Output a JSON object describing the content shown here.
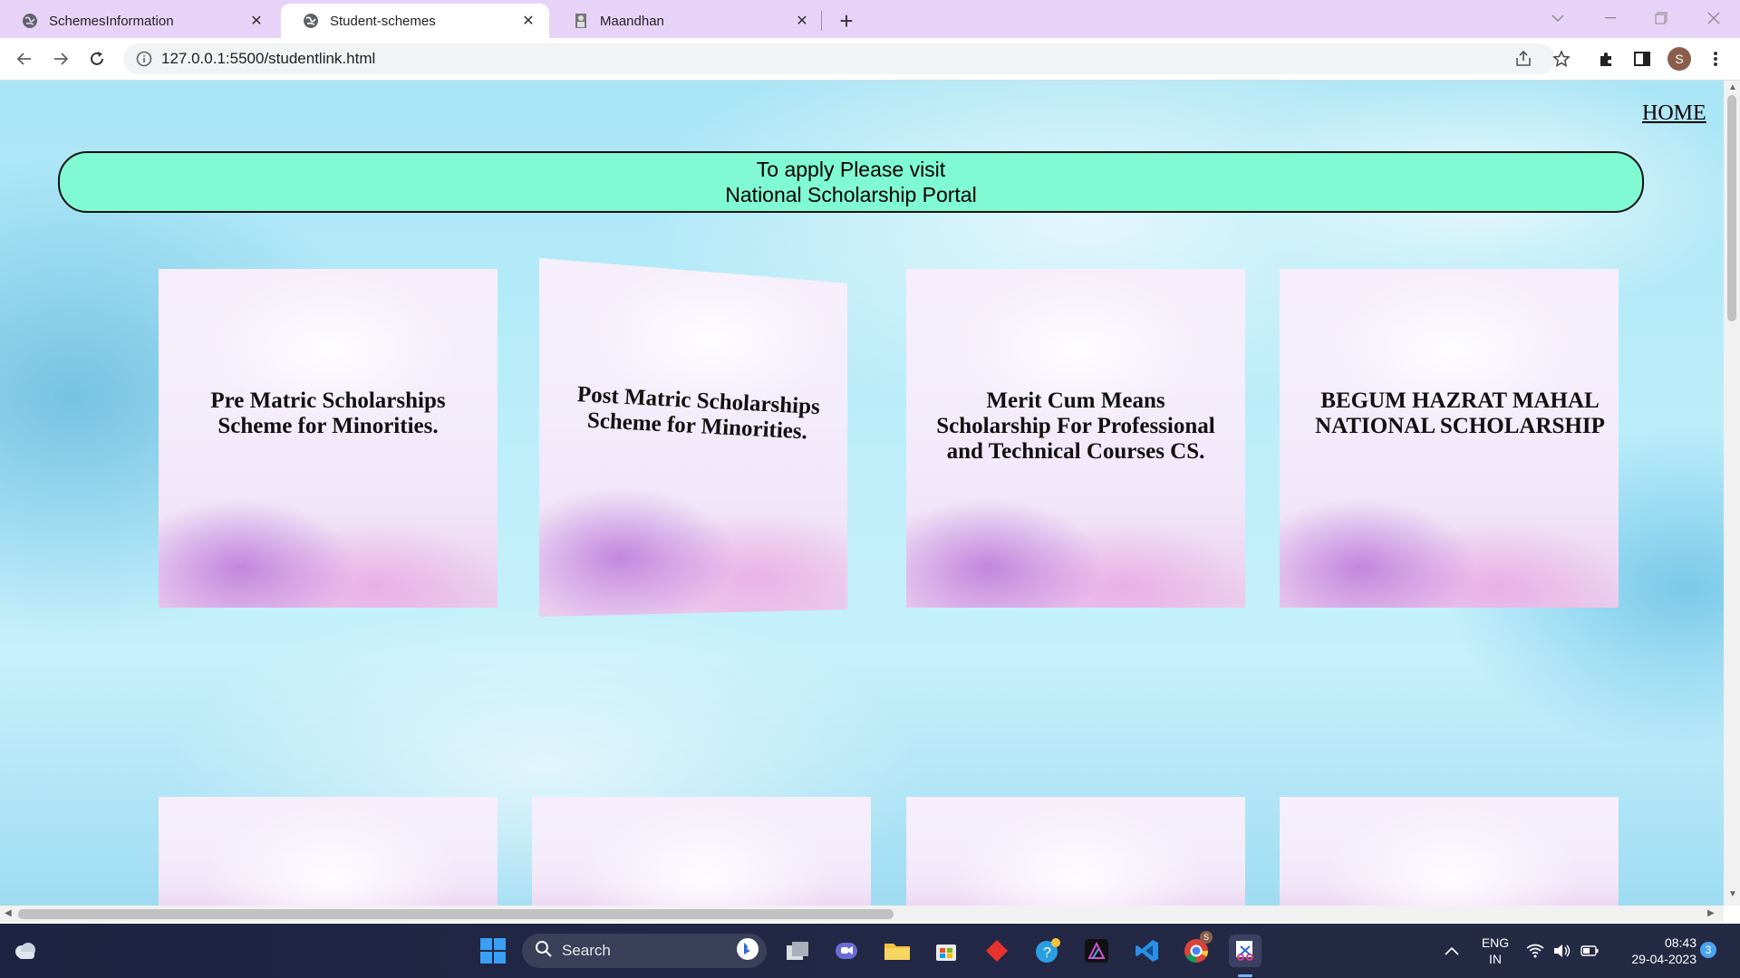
{
  "browser": {
    "tabs": [
      {
        "title": "SchemesInformation",
        "icon": "globe-icon",
        "active": false
      },
      {
        "title": "Student-schemes",
        "icon": "globe-icon",
        "active": true
      },
      {
        "title": "Maandhan",
        "icon": "person-icon",
        "active": false
      }
    ],
    "url": "127.0.0.1:5500/studentlink.html"
  },
  "page": {
    "home_link": "HOME",
    "banner_line1": "To apply Please visit",
    "banner_line2": "National Scholarship Portal",
    "cards": [
      "Pre Matric Scholarships Scheme for Minorities.",
      "Post Matric Scholarships Scheme for Minorities.",
      "Merit Cum Means Scholarship For Professional and Technical Courses CS.",
      "BEGUM HAZRAT MAHAL NATIONAL SCHOLARSHIP"
    ]
  },
  "taskbar": {
    "search_label": "Search",
    "lang_line1": "ENG",
    "lang_line2": "IN",
    "time": "08:43",
    "date": "29-04-2023",
    "notification_count": "3",
    "avatar_letter": "S",
    "chrome_badge": "S"
  }
}
